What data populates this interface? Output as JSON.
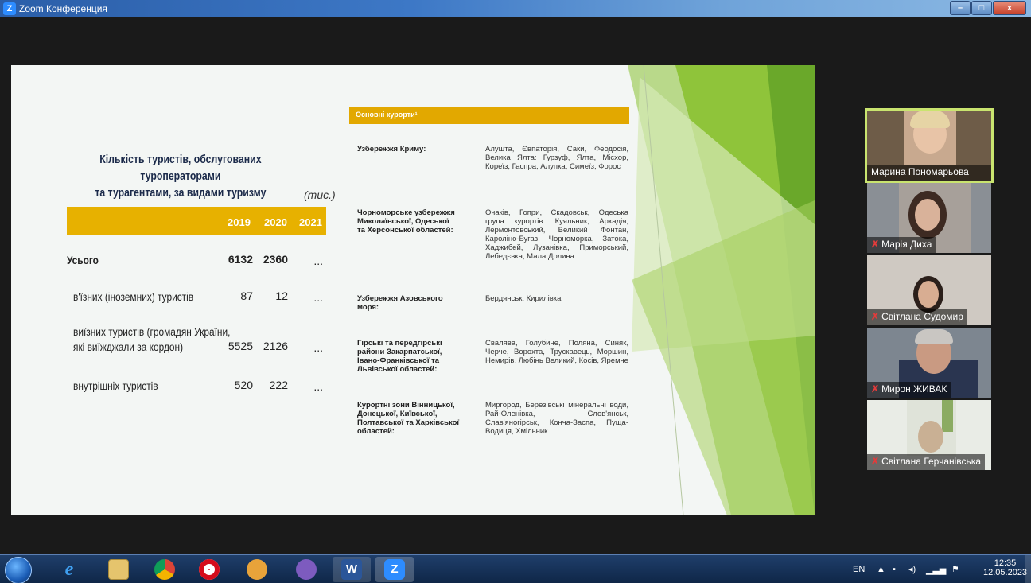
{
  "window": {
    "title": "Zoom Конференция",
    "app_icon_letter": "Z",
    "buttons": {
      "minimize": "–",
      "maximize": "□",
      "close": "x"
    }
  },
  "slide": {
    "left_title_line1": "Кількість туристів, обслугованих туроператорами",
    "left_title_line2": "та турагентами, за видами туризму",
    "unit": "(тис.)",
    "years": [
      "2019",
      "2020",
      "2021"
    ],
    "rows": [
      {
        "label": "Усього",
        "v2019": "6132",
        "v2020": "2360",
        "v2021": "..."
      },
      {
        "label": "в'їзних (іноземних) туристів",
        "v2019": "87",
        "v2020": "12",
        "v2021": "..."
      },
      {
        "label_line1": "виїзних туристів (громадян України,",
        "label_line2": "які виїжджали за кордон)",
        "v2019": "5525",
        "v2020": "2126",
        "v2021": "..."
      },
      {
        "label": "внутрішніх туристів",
        "v2019": "520",
        "v2020": "222",
        "v2021": "..."
      }
    ],
    "resorts_header": "Основні курорти¹",
    "resorts": [
      {
        "region": [
          "Узбережжя Криму:"
        ],
        "towns": "Алушта, Євпаторія, Саки, Феодосія, Велика Ялта: Гурзуф, Ялта, Місхор, Кореїз, Гаспра, Алупка, Симеїз, Форос"
      },
      {
        "region": [
          "Чорноморське узбережжя",
          "Миколаївської, Одеської",
          "та Херсонської областей:"
        ],
        "towns": "Очаків, Гопри, Скадовськ, Одеська група курортів: Куяльник, Аркадія, Лермонтовський, Великий Фонтан, Кароліно-Бугаз, Чорноморка, Затока, Хаджибей, Лузанівка, Приморський, Лебедєвка, Мала Долина"
      },
      {
        "region": [
          "Узбережжя Азовського",
          "моря:"
        ],
        "towns": "Бердянськ, Кирилівка"
      },
      {
        "region": [
          "Гірські та передгірські",
          "райони Закарпатської,",
          "Івано-Франківської та",
          "Львівської областей:"
        ],
        "towns": "Свалява, Голубине, Поляна, Синяк, Черче, Ворохта, Трускавець, Моршин, Немирів, Любінь Великий, Косів, Яремче"
      },
      {
        "region": [
          "Курортні зони Вінницької,",
          "Донецької, Київської,",
          "Полтавської та Харківської",
          "областей:"
        ],
        "towns": "Миргород, Березівські мінеральні води, Рай-Оленівка, Слов'янськ, Слав'яногірськ, Конча-Заспа, Пуща-Водиця, Хмільник"
      }
    ]
  },
  "participants": [
    {
      "name": "Марина Пономарьова",
      "muted": false,
      "active": true
    },
    {
      "name": "Марія Диха",
      "muted": true
    },
    {
      "name": "Світлана Судомир",
      "muted": true
    },
    {
      "name": "Мирон ЖИВАК",
      "muted": true
    },
    {
      "name": "Світлана Герчанівська",
      "muted": true
    }
  ],
  "taskbar": {
    "language": "EN",
    "time": "12:35",
    "date": "12.05.2023",
    "apps": [
      "internet-explorer",
      "file-explorer",
      "chrome",
      "opera",
      "photo-viewer",
      "viber",
      "word",
      "zoom"
    ],
    "word_letter": "W",
    "zoom_letter": "Z"
  }
}
